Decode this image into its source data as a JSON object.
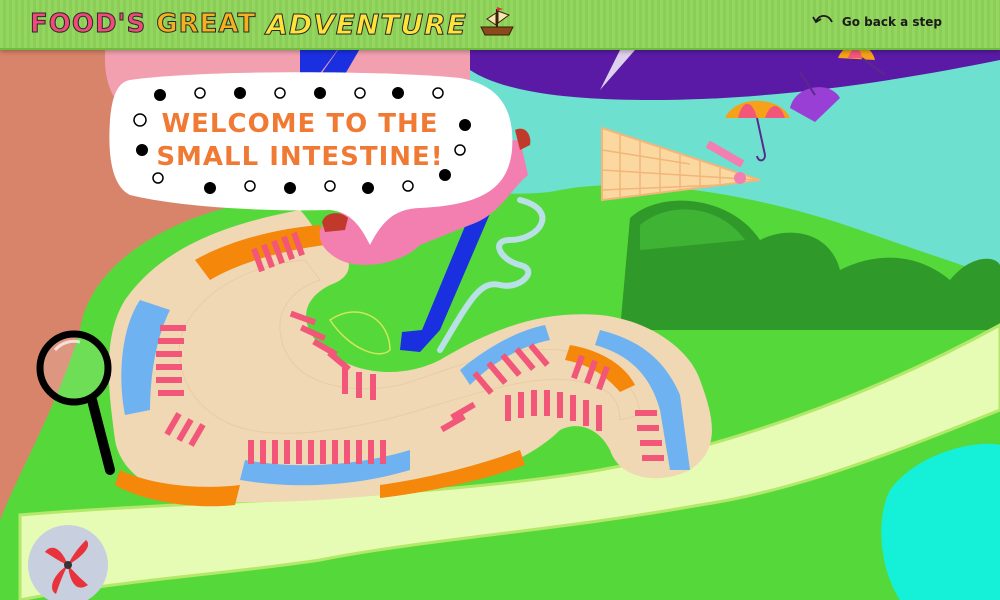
{
  "header": {
    "logo_words": [
      "FOOD'S",
      "GREAT",
      "ADVENTURE"
    ],
    "back_label": "Go back a step"
  },
  "speech_bubble": {
    "line1": "WELCOME TO THE",
    "line2": "SMALL INTESTINE!"
  },
  "icons": [
    "ship-icon",
    "back-arrow-icon",
    "magnifier-icon",
    "fan-icon",
    "umbrella-icon"
  ],
  "colors": {
    "header_green": "#8fd45a",
    "grass_green": "#55d93a",
    "intestine_path": "#f0d8b5",
    "villi_pink": "#f25779",
    "fluid_blue": "#6fb2f2",
    "orange_band": "#f5870a",
    "sky_teal": "#6de0d0",
    "bubble_text": "#f07a34"
  }
}
